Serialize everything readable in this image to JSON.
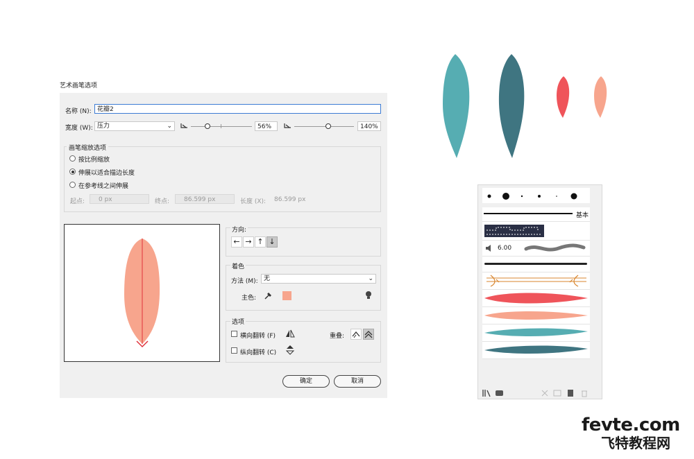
{
  "dialog": {
    "title": "艺术画笔选项",
    "name_label": "名称 (N):",
    "name_value": "花瓣2",
    "width_label": "宽度 (W):",
    "width_method": "压力",
    "min_width": "56%",
    "max_width": "140%",
    "scale_group": {
      "title": "画笔缩放选项",
      "options": [
        "按比例缩放",
        "伸展以适合描边长度",
        "在参考线之间伸展"
      ],
      "selected_index": 1,
      "start_label": "起点:",
      "start_value": "0 px",
      "end_label": "终点:",
      "end_value": "86.599 px",
      "length_label": "长度 (X):",
      "length_value": "86.599 px"
    },
    "direction": {
      "title": "方向:",
      "arrows": [
        "←",
        "→",
        "↑",
        "↓"
      ],
      "selected_index": 3
    },
    "colorization": {
      "title": "着色",
      "method_label": "方法 (M):",
      "method_value": "无",
      "key_color_label": "主色:",
      "key_color": "#f7a58d"
    },
    "options": {
      "title": "选项",
      "flip_along_label": "横向翻转 (F)",
      "flip_across_label": "纵向翻转 (C)",
      "overlap_label": "重叠:"
    },
    "ok_label": "确定",
    "cancel_label": "取消"
  },
  "preview": {
    "petal_color": "#f7a58d",
    "guide_color": "#e0323c"
  },
  "petals": {
    "colors": [
      "#56adb2",
      "#3f7581",
      "#ef545a",
      "#f7a58d"
    ]
  },
  "brushes_panel": {
    "basic_label": "基本",
    "size_value": "6.00",
    "art_brush_colors": [
      "#ef545a",
      "#f7a58d",
      "#56adb2",
      "#3f7581"
    ]
  },
  "watermark": {
    "line1": "fevte.com",
    "line2": "飞特教程网"
  }
}
